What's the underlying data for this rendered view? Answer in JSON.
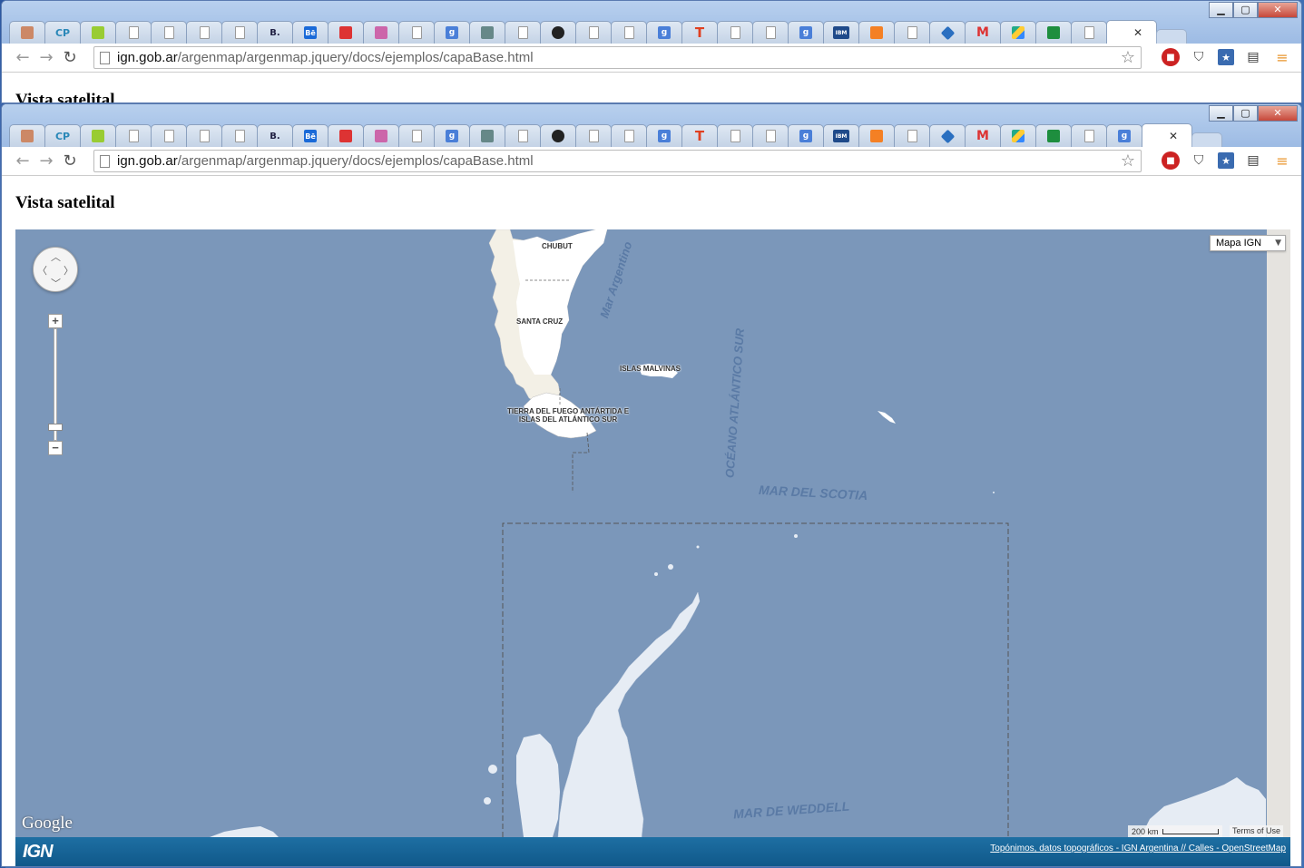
{
  "browser": {
    "url_host": "ign.gob.ar",
    "url_path": "/argenmap/argenmap.jquery/docs/ejemplos/capaBase.html",
    "window_controls": {
      "minimize": "▁",
      "maximize": "▢",
      "close": "✕"
    },
    "tab_close": "✕",
    "tabs": [
      {
        "icon": "notepad-icon",
        "text": ""
      },
      {
        "icon": "codepen-icon",
        "text": "CP"
      },
      {
        "icon": "green-square-icon",
        "text": ""
      },
      {
        "icon": "doc-icon",
        "text": ""
      },
      {
        "icon": "doc-icon",
        "text": ""
      },
      {
        "icon": "doc-icon",
        "text": ""
      },
      {
        "icon": "doc-icon",
        "text": ""
      },
      {
        "icon": "b-icon",
        "text": "B."
      },
      {
        "icon": "behance-icon",
        "text": "Bē"
      },
      {
        "icon": "sync-icon",
        "text": ""
      },
      {
        "icon": "cube-icon",
        "text": ""
      },
      {
        "icon": "doc-icon",
        "text": ""
      },
      {
        "icon": "google-icon",
        "text": "g"
      },
      {
        "icon": "bear-icon",
        "text": ""
      },
      {
        "icon": "doc-icon",
        "text": ""
      },
      {
        "icon": "github-icon",
        "text": ""
      },
      {
        "icon": "doc-icon",
        "text": ""
      },
      {
        "icon": "doc-icon",
        "text": ""
      },
      {
        "icon": "google-icon",
        "text": "g"
      },
      {
        "icon": "t-icon",
        "text": "T"
      },
      {
        "icon": "doc-icon",
        "text": ""
      },
      {
        "icon": "doc-icon",
        "text": ""
      },
      {
        "icon": "google-icon",
        "text": "g"
      },
      {
        "icon": "ibm-icon",
        "text": "IBM"
      },
      {
        "icon": "stackoverflow-icon",
        "text": ""
      },
      {
        "icon": "doc-icon",
        "text": ""
      },
      {
        "icon": "diamond-icon",
        "text": ""
      },
      {
        "icon": "gmail-icon",
        "text": "M"
      },
      {
        "icon": "drive-icon",
        "text": ""
      },
      {
        "icon": "sheets-icon",
        "text": ""
      },
      {
        "icon": "doc-icon",
        "text": ""
      }
    ],
    "front_tabs_extra_google": "g",
    "extensions": [
      "adblock-icon",
      "pocket-icon",
      "bookmark-icon",
      "folder-icon",
      "menu-icon"
    ]
  },
  "page": {
    "title": "Vista satelital"
  },
  "map": {
    "maptype_selected": "Mapa IGN",
    "labels": {
      "chubut": "CHUBUT",
      "santa_cruz": "SANTA CRUZ",
      "malvinas": "ISLAS MALVINAS",
      "tierra_del_fuego_1": "TIERRA DEL FUEGO ANTÁRTIDA E",
      "tierra_del_fuego_2": "ISLAS DEL ATLÁNTICO SUR",
      "mar_argentino": "Mar Argentino",
      "oceano": "OCÉANO ATLÁNTICO SUR",
      "mar_scotia": "MAR DEL SCOTIA",
      "mar_weddell": "MAR DE WEDDELL"
    },
    "google_logo": "Google",
    "scale_text": "200 km",
    "terms": "Terms of Use",
    "ign_logo": "IGN",
    "credits": "Topónimos, datos topográficos - IGN Argentina // Calles - OpenStreetMap",
    "colors": {
      "water": "#7b97ba",
      "land": "#ffffff",
      "ice": "#e6ecf4"
    }
  }
}
